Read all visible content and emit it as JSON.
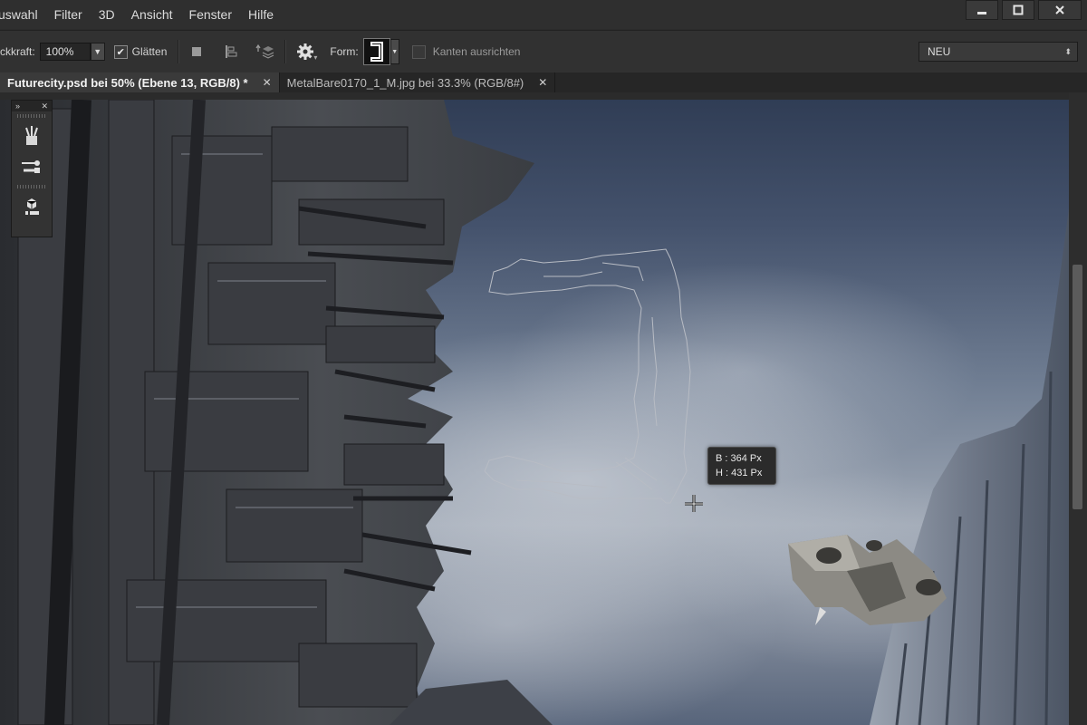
{
  "menubar": {
    "items": [
      "uswahl",
      "Filter",
      "3D",
      "Ansicht",
      "Fenster",
      "Hilfe"
    ],
    "window_controls": {
      "minimize": "minimize-icon",
      "maximize": "maximize-icon",
      "close": "close-icon"
    }
  },
  "options": {
    "opacity_label": "ckkraft:",
    "opacity_value": "100%",
    "smooth_label": "Glätten",
    "smooth_checked": true,
    "shape_label": "Form:",
    "align_edges_label": "Kanten ausrichten",
    "align_edges_checked": false,
    "mode_select": "NEU",
    "icons": [
      "path-operations-icon",
      "path-alignment-icon",
      "path-arrangement-icon",
      "gear-icon"
    ]
  },
  "tabs": [
    {
      "label": "Futurecity.psd bei 50% (Ebene 13, RGB/8) *",
      "active": true
    },
    {
      "label": "MetalBare0170_1_M.jpg bei 33.3% (RGB/8#)",
      "active": false
    }
  ],
  "tool_panel": {
    "icons": [
      "brush-presets-icon",
      "tool-presets-icon",
      "3d-panel-icon"
    ]
  },
  "tooltip": {
    "width_line": "B :  364 Px",
    "height_line": "H :  431 Px"
  },
  "colors": {
    "ui_background": "#2b2b2b",
    "active_tab": "#3a3a3a",
    "sky_top": "#303d55",
    "sky_light": "#9ea7b4"
  }
}
